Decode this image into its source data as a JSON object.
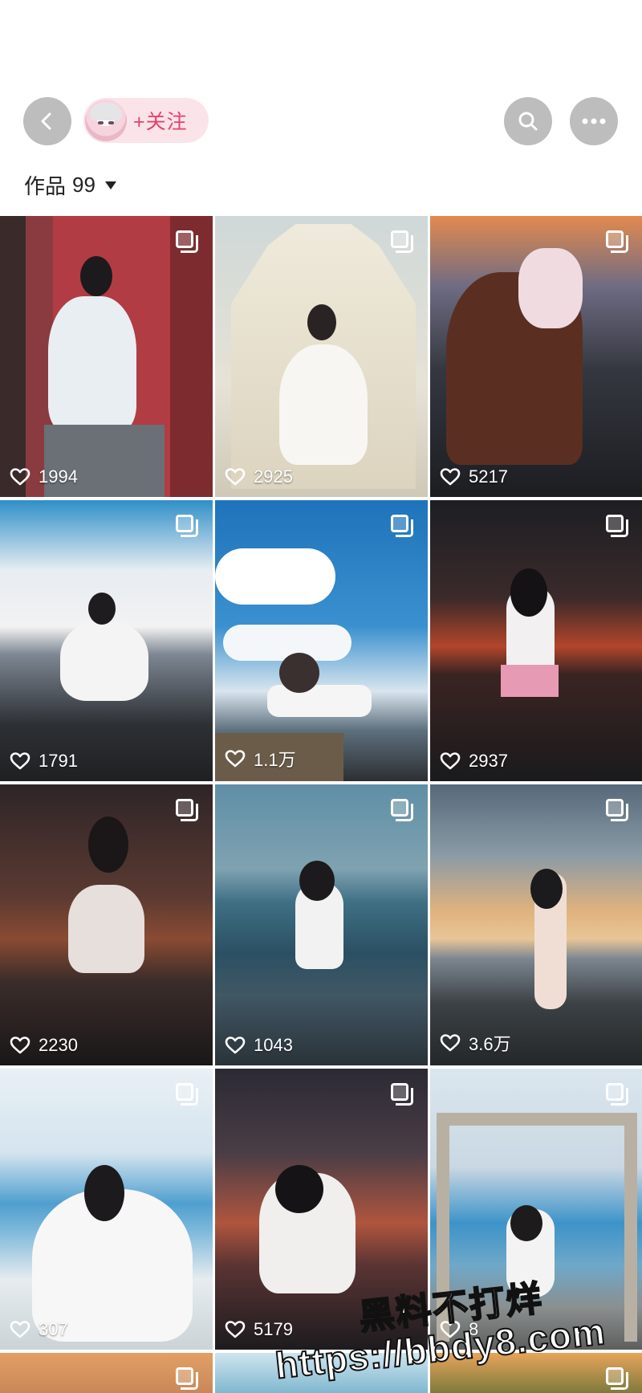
{
  "header": {
    "follow_label": "+关注",
    "works_label": "作品",
    "works_count": "99"
  },
  "posts": [
    {
      "likes": "1994",
      "multi": true
    },
    {
      "likes": "2925",
      "multi": true
    },
    {
      "likes": "5217",
      "multi": true
    },
    {
      "likes": "1791",
      "multi": true
    },
    {
      "likes": "1.1万",
      "multi": true
    },
    {
      "likes": "2937",
      "multi": true
    },
    {
      "likes": "2230",
      "multi": true
    },
    {
      "likes": "1043",
      "multi": true
    },
    {
      "likes": "3.6万",
      "multi": true
    },
    {
      "likes": "307",
      "multi": true
    },
    {
      "likes": "5179",
      "multi": true
    },
    {
      "likes": "8",
      "multi": true
    }
  ],
  "watermark": {
    "line1": "黑料不打烊",
    "line2": "https://bbdy8.com"
  },
  "icons": [
    "chevron-left-icon",
    "search-icon",
    "more-icon",
    "heart-icon",
    "multi-image-icon",
    "dropdown-caret-icon"
  ]
}
